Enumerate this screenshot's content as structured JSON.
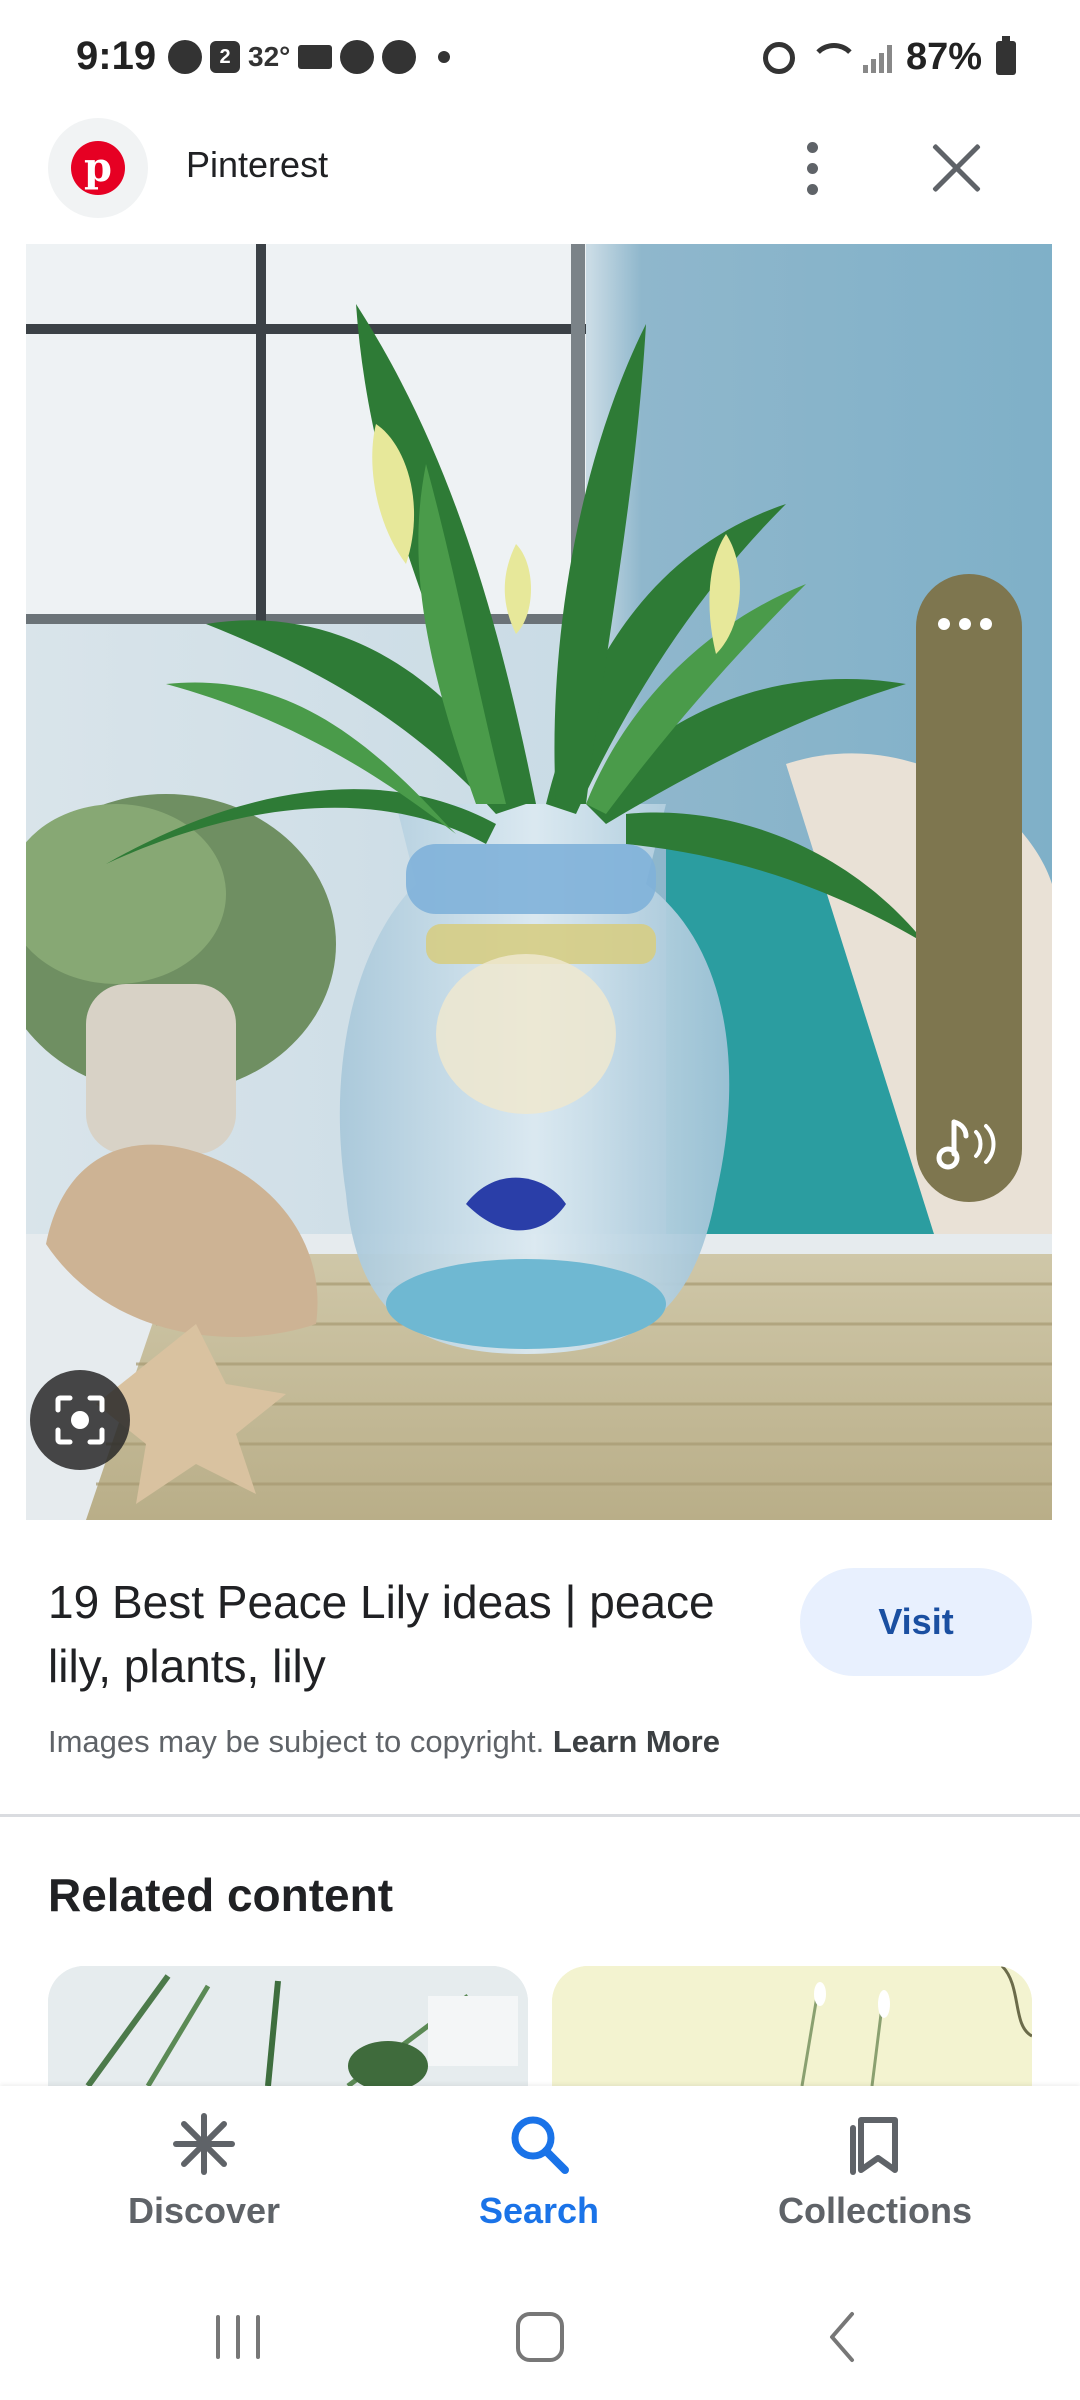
{
  "status_bar": {
    "time": "9:19",
    "calendar_day": "2",
    "temperature": "32°",
    "battery": "87%"
  },
  "header": {
    "site_name": "Pinterest",
    "logo_letter": "p"
  },
  "result": {
    "title": "19 Best Peace Lily ideas | peace lily, plants, lily",
    "visit_label": "Visit",
    "copyright_text": "Images may be subject to copyright.",
    "learn_more_label": "Learn More"
  },
  "related": {
    "heading": "Related content"
  },
  "bottom_nav": {
    "items": [
      {
        "label": "Discover",
        "icon": "asterisk-icon"
      },
      {
        "label": "Search",
        "icon": "search-icon",
        "active": true
      },
      {
        "label": "Collections",
        "icon": "collections-icon"
      }
    ]
  },
  "colors": {
    "accent": "#1a73e8",
    "visit_bg": "#e8f0fe",
    "side_panel": "#7e764f",
    "pinterest_red": "#e60023"
  }
}
